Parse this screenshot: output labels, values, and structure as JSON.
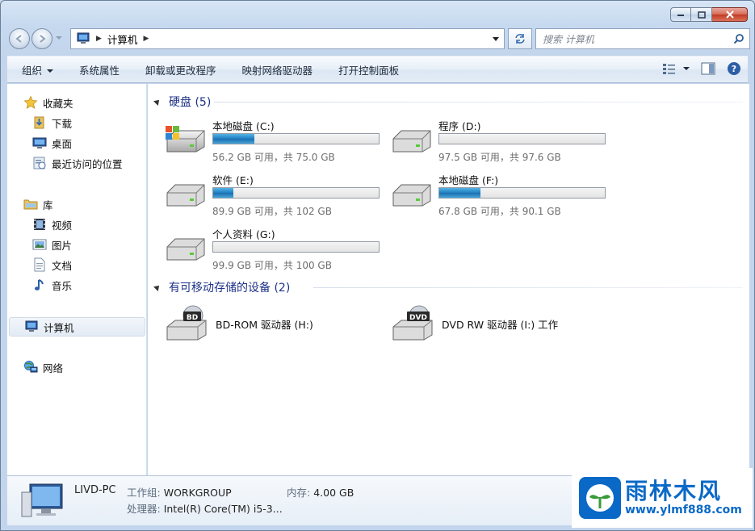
{
  "window": {
    "buttons": {
      "minimize": "minimize",
      "maximize": "maximize",
      "close": "close"
    }
  },
  "address": {
    "crumb": "计算机",
    "search_placeholder": "搜索 计算机"
  },
  "toolbar": {
    "organize": "组织",
    "system_properties": "系统属性",
    "uninstall": "卸载或更改程序",
    "map_drive": "映射网络驱动器",
    "control_panel": "打开控制面板"
  },
  "sidebar": {
    "favorites": "收藏夹",
    "downloads": "下载",
    "desktop": "桌面",
    "recent": "最近访问的位置",
    "libraries": "库",
    "videos": "视频",
    "pictures": "图片",
    "documents": "文档",
    "music": "音乐",
    "computer": "计算机",
    "network": "网络"
  },
  "hard_disks": {
    "title": "硬盘 (5)",
    "drives": [
      {
        "name": "本地磁盘 (C:)",
        "space": "56.2 GB 可用，共 75.0 GB",
        "used_fraction": 0.25,
        "icon": "windows-drive-icon"
      },
      {
        "name": "程序 (D:)",
        "space": "97.5 GB 可用，共 97.6 GB",
        "used_fraction": 0.0,
        "icon": "hard-drive-icon"
      },
      {
        "name": "软件 (E:)",
        "space": "89.9 GB 可用，共 102 GB",
        "used_fraction": 0.12,
        "icon": "hard-drive-icon"
      },
      {
        "name": "本地磁盘 (F:)",
        "space": "67.8 GB 可用，共 90.1 GB",
        "used_fraction": 0.25,
        "icon": "hard-drive-icon"
      },
      {
        "name": "个人资料 (G:)",
        "space": "99.9 GB 可用，共 100 GB",
        "used_fraction": 0.0,
        "icon": "hard-drive-icon"
      }
    ]
  },
  "removable": {
    "title": "有可移动存储的设备 (2)",
    "drives": [
      {
        "name": "BD-ROM 驱动器 (H:)",
        "badge": "BD",
        "icon": "bd-rom-drive-icon"
      },
      {
        "name": "DVD RW 驱动器 (I:) 工作",
        "badge": "DVD",
        "icon": "dvd-rw-drive-icon"
      }
    ]
  },
  "details": {
    "pc_name": "LIVD-PC",
    "workgroup_label": "工作组:",
    "workgroup_value": "WORKGROUP",
    "memory_label": "内存:",
    "memory_value": "4.00 GB",
    "processor_label": "处理器:",
    "processor_value": "Intel(R) Core(TM) i5-3..."
  },
  "watermark": {
    "brand": "雨林木风",
    "url": "www.ylmf888.com"
  },
  "colors": {
    "progress_fill": "#1f7ec2",
    "group_header": "#1e3287",
    "watermark": "#0a69c7"
  }
}
